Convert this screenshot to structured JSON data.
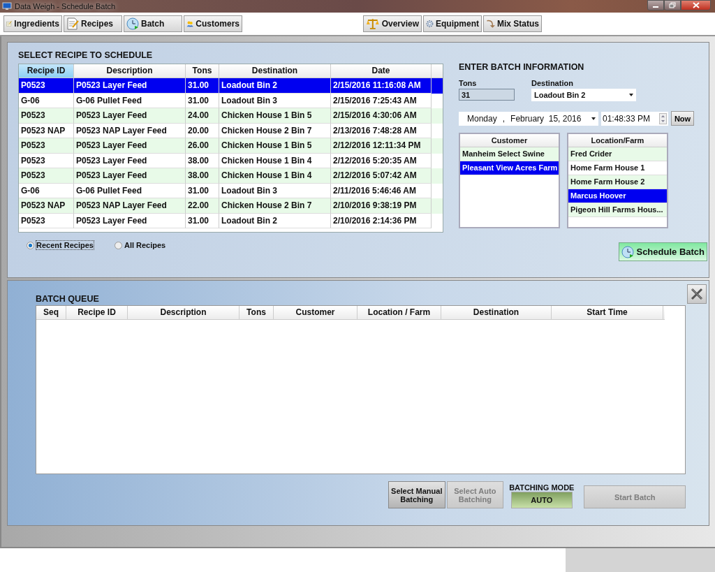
{
  "window": {
    "title": "Data Weigh - Schedule Batch"
  },
  "toolbar": {
    "left": [
      {
        "label": "Ingredients",
        "kind": "ingredients"
      },
      {
        "label": "Recipes",
        "kind": "recipes"
      },
      {
        "label": "Batch",
        "kind": "batch"
      },
      {
        "label": "Customers",
        "kind": "customers"
      }
    ],
    "right": [
      {
        "label": "Overview",
        "kind": "overview"
      },
      {
        "label": "Equipment",
        "kind": "equipment"
      },
      {
        "label": "Mix Status",
        "kind": "mix"
      }
    ]
  },
  "recipe_panel": {
    "title": "SELECT RECIPE TO SCHEDULE",
    "columns": [
      {
        "label": "Recipe ID",
        "selected": true
      },
      {
        "label": "Description",
        "selected": false
      },
      {
        "label": "Tons",
        "selected": false
      },
      {
        "label": "Destination",
        "selected": false
      },
      {
        "label": "Date",
        "selected": false
      }
    ],
    "rows": [
      {
        "cells": [
          "P0523",
          "P0523 Layer Feed",
          "31.00",
          "Loadout Bin 2",
          "2/15/2016 11:16:08 AM"
        ],
        "selected": true
      },
      {
        "cells": [
          "G-06",
          "G-06 Pullet Feed",
          "31.00",
          "Loadout Bin 3",
          "2/15/2016 7:25:43 AM"
        ],
        "selected": false
      },
      {
        "cells": [
          "P0523",
          "P0523 Layer Feed",
          "24.00",
          "Chicken House 1 Bin 5",
          "2/15/2016 4:30:06 AM"
        ],
        "selected": false
      },
      {
        "cells": [
          "P0523 NAP",
          "P0523 NAP Layer Feed",
          "20.00",
          "Chicken House 2 Bin 7",
          "2/13/2016 7:48:28 AM"
        ],
        "selected": false
      },
      {
        "cells": [
          "P0523",
          "P0523 Layer Feed",
          "26.00",
          "Chicken House 1 Bin 5",
          "2/12/2016 12:11:34 PM"
        ],
        "selected": false
      },
      {
        "cells": [
          "P0523",
          "P0523 Layer Feed",
          "38.00",
          "Chicken House 1 Bin 4",
          "2/12/2016 5:20:35 AM"
        ],
        "selected": false
      },
      {
        "cells": [
          "P0523",
          "P0523 Layer Feed",
          "38.00",
          "Chicken House 1 Bin 4",
          "2/12/2016 5:07:42 AM"
        ],
        "selected": false
      },
      {
        "cells": [
          "G-06",
          "G-06 Pullet Feed",
          "31.00",
          "Loadout Bin 3",
          "2/11/2016 5:46:46 AM"
        ],
        "selected": false
      },
      {
        "cells": [
          "P0523 NAP",
          "P0523 NAP Layer Feed",
          "22.00",
          "Chicken House 2 Bin 7",
          "2/10/2016 9:38:19 PM"
        ],
        "selected": false
      },
      {
        "cells": [
          "P0523",
          "P0523 Layer Feed",
          "31.00",
          "Loadout Bin 2",
          "2/10/2016 2:14:36 PM"
        ],
        "selected": false
      }
    ],
    "filters": [
      {
        "label": "Recent Recipes",
        "selected": true
      },
      {
        "label": "All Recipes",
        "selected": false
      }
    ]
  },
  "batch_info": {
    "title": "ENTER BATCH INFORMATION",
    "tons_label": "Tons",
    "tons_value": "31",
    "destination_label": "Destination",
    "destination_value": "Loadout Bin 2",
    "weekday": "Monday",
    "date_separator": ",",
    "date": "February  15, 2016",
    "time": "01:48:33 PM",
    "now_button": "Now",
    "customer_header": "Customer",
    "customers": [
      {
        "name": "Manheim Select Swine",
        "selected": false
      },
      {
        "name": "Pleasant View Acres Farm",
        "selected": true
      }
    ],
    "location_header": "Location/Farm",
    "locations": [
      {
        "name": "Fred Crider",
        "selected": false
      },
      {
        "name": "Home Farm House 1",
        "selected": false
      },
      {
        "name": "Home Farm House 2",
        "selected": false
      },
      {
        "name": "Marcus Hoover",
        "selected": true
      },
      {
        "name": "Pigeon Hill Farms  Hous...",
        "selected": false
      }
    ],
    "schedule_button": "Schedule Batch"
  },
  "batch_queue": {
    "title": "BATCH QUEUE",
    "columns": [
      "Seq",
      "Recipe ID",
      "Description",
      "Tons",
      "Customer",
      "Location / Farm",
      "Destination",
      "Start Time"
    ],
    "manual_button": {
      "label": "Select Manual Batching",
      "disabled": false
    },
    "auto_button": {
      "label": "Select Auto Batching",
      "disabled": true
    },
    "mode_label": "BATCHING MODE",
    "mode_value": "AUTO",
    "start_button": {
      "label": "Start Batch",
      "disabled": true
    }
  }
}
